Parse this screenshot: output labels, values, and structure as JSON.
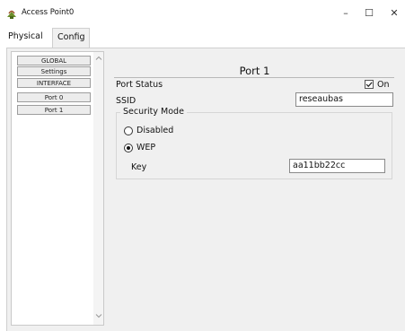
{
  "window": {
    "title": "Access Point0",
    "minimize": "–",
    "maximize": "☐",
    "close": "✕"
  },
  "tabs": [
    {
      "label": "Physical"
    },
    {
      "label": "Config",
      "selected": true
    }
  ],
  "sidebar": {
    "items": [
      {
        "label": "GLOBAL"
      },
      {
        "label": "Settings"
      },
      {
        "label": "INTERFACE"
      },
      {
        "label": "Port 0"
      },
      {
        "label": "Port 1",
        "selected": true
      }
    ]
  },
  "content": {
    "title": "Port 1",
    "port_status": {
      "label": "Port Status",
      "checkbox_label": "On",
      "checked": true
    },
    "ssid": {
      "label": "SSID",
      "value": "reseaubas"
    },
    "security": {
      "legend": "Security Mode",
      "options": [
        {
          "label": "Disabled",
          "selected": false
        },
        {
          "label": "WEP",
          "selected": true
        }
      ],
      "key": {
        "label": "Key",
        "value": "aa11bb22cc"
      }
    }
  }
}
